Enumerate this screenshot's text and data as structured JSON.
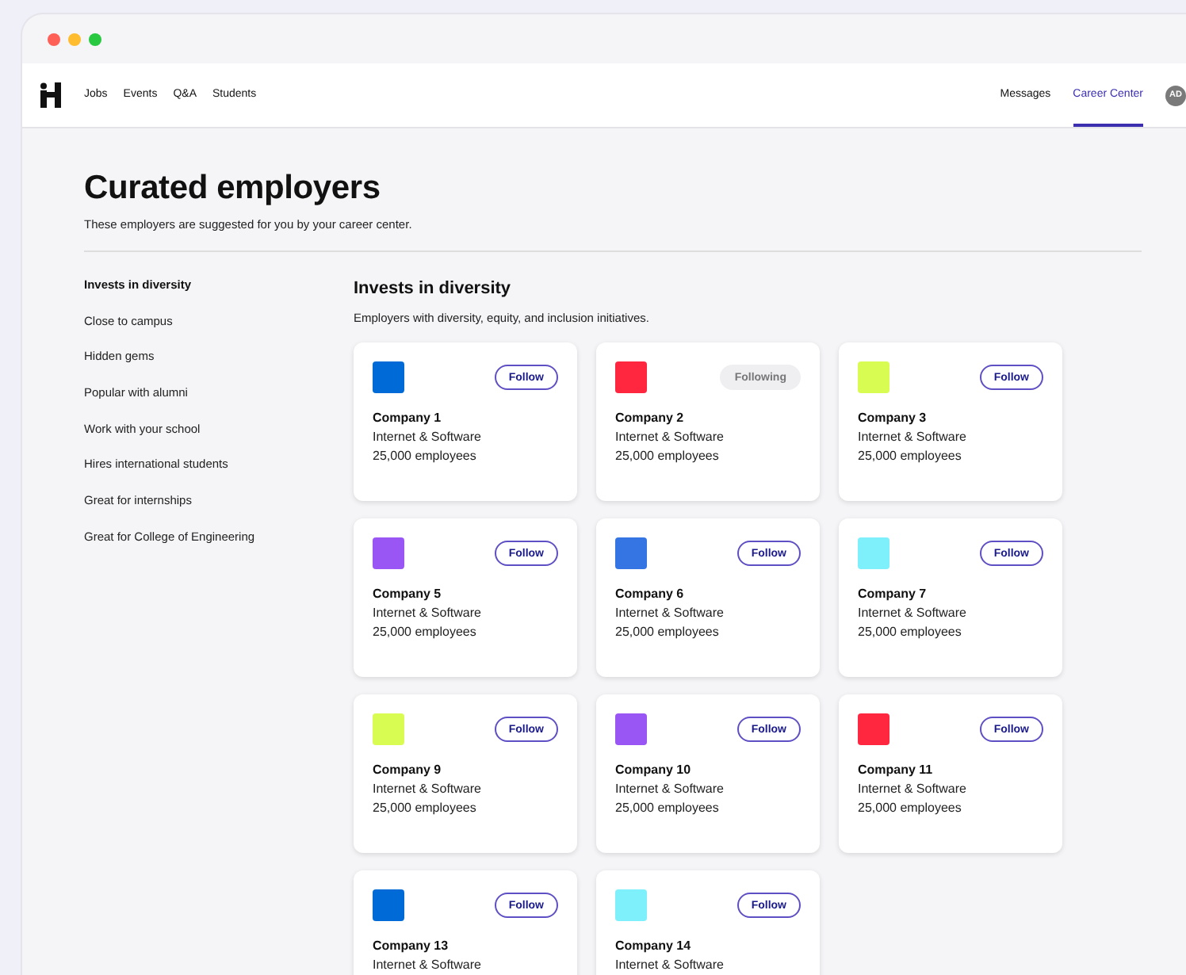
{
  "nav": {
    "links": [
      {
        "label": "Jobs",
        "selected": false
      },
      {
        "label": "Events",
        "selected": false
      },
      {
        "label": "Q&A",
        "selected": false
      },
      {
        "label": "Students",
        "selected": false
      }
    ],
    "right_links": [
      {
        "label": "Messages",
        "selected": false
      },
      {
        "label": "Career Center",
        "selected": true
      }
    ],
    "avatar": "AD"
  },
  "page": {
    "title": "Curated employers",
    "subtitle": "These employers are suggested for you by your career center."
  },
  "sidebar": {
    "items": [
      {
        "label": "Invests in diversity",
        "selected": true
      },
      {
        "label": "Close to campus",
        "selected": false
      },
      {
        "label": "Hidden gems",
        "selected": false
      },
      {
        "label": "Popular with alumni",
        "selected": false
      },
      {
        "label": "Work with your school",
        "selected": false
      },
      {
        "label": "Hires international students",
        "selected": false
      },
      {
        "label": "Great for internships",
        "selected": false
      },
      {
        "label": "Great for College of Engineering",
        "selected": false
      }
    ]
  },
  "section": {
    "title": "Invests in diversity",
    "description": "Employers with diversity, equity, and inclusion initiatives."
  },
  "employers": [
    {
      "name": "Company 1",
      "industry": "Internet & Software",
      "size": "25,000 employees",
      "color": "#006bd6",
      "button": "Follow",
      "following": false
    },
    {
      "name": "Company 2",
      "industry": "Internet & Software",
      "size": "25,000 employees",
      "color": "#ff2640",
      "button": "Following",
      "following": true
    },
    {
      "name": "Company 3",
      "industry": "Internet & Software",
      "size": "25,000 employees",
      "color": "#d9fc52",
      "button": "Follow",
      "following": false
    },
    {
      "name": "Company 5",
      "industry": "Internet & Software",
      "size": "25,000 employees",
      "color": "#9a55f5",
      "button": "Follow",
      "following": false
    },
    {
      "name": "Company 6",
      "industry": "Internet & Software",
      "size": "25,000 employees",
      "color": "#3575e3",
      "button": "Follow",
      "following": false
    },
    {
      "name": "Company 7",
      "industry": "Internet & Software",
      "size": "25,000 employees",
      "color": "#7ef0fb",
      "button": "Follow",
      "following": false
    },
    {
      "name": "Company 9",
      "industry": "Internet & Software",
      "size": "25,000 employees",
      "color": "#d9fc52",
      "button": "Follow",
      "following": false
    },
    {
      "name": "Company 10",
      "industry": "Internet & Software",
      "size": "25,000 employees",
      "color": "#9a55f5",
      "button": "Follow",
      "following": false
    },
    {
      "name": "Company 11",
      "industry": "Internet & Software",
      "size": "25,000 employees",
      "color": "#ff2640",
      "button": "Follow",
      "following": false
    },
    {
      "name": "Company 13",
      "industry": "Internet & Software",
      "color": "#006bd6",
      "button": "Follow",
      "following": false
    },
    {
      "name": "Company 14",
      "industry": "Internet & Software",
      "color": "#7ef0fb",
      "button": "Follow",
      "following": false
    }
  ]
}
